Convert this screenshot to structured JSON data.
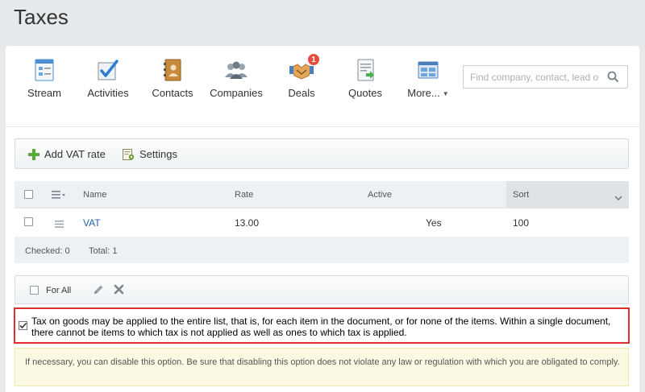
{
  "page": {
    "title": "Taxes"
  },
  "nav": {
    "items": [
      {
        "label": "Stream",
        "icon": "stream-icon"
      },
      {
        "label": "Activities",
        "icon": "activities-icon"
      },
      {
        "label": "Contacts",
        "icon": "contacts-icon"
      },
      {
        "label": "Companies",
        "icon": "companies-icon"
      },
      {
        "label": "Deals",
        "icon": "deals-icon",
        "badge": "1"
      },
      {
        "label": "Quotes",
        "icon": "quotes-icon"
      },
      {
        "label": "More...",
        "icon": "more-icon"
      }
    ]
  },
  "search": {
    "placeholder": "Find company, contact, lead o"
  },
  "toolbar": {
    "add_label": "Add VAT rate",
    "settings_label": "Settings"
  },
  "grid": {
    "columns": {
      "name": "Name",
      "rate": "Rate",
      "active": "Active",
      "sort": "Sort"
    },
    "rows": [
      {
        "name": "VAT",
        "rate": "13.00",
        "active": "Yes",
        "sort": "100"
      }
    ],
    "footer": {
      "checked": "Checked: 0",
      "total": "Total: 1"
    }
  },
  "action_bar": {
    "for_all_label": "For All"
  },
  "notice": {
    "checked": true,
    "text": "Tax on goods may be applied to the entire list, that is, for each item in the document, or for none of the items. Within a single document, there cannot be items to which tax is not applied as well as ones to which tax is applied."
  },
  "warning": {
    "text": "If necessary, you can disable this option. Be sure that disabling this option does not violate any law or regulation with which you are obligated to comply."
  },
  "colors": {
    "accent_link": "#2067b0",
    "badge": "#e74c3c",
    "highlight_border": "#e02d2d",
    "warning_bg": "#fcf9e3"
  }
}
